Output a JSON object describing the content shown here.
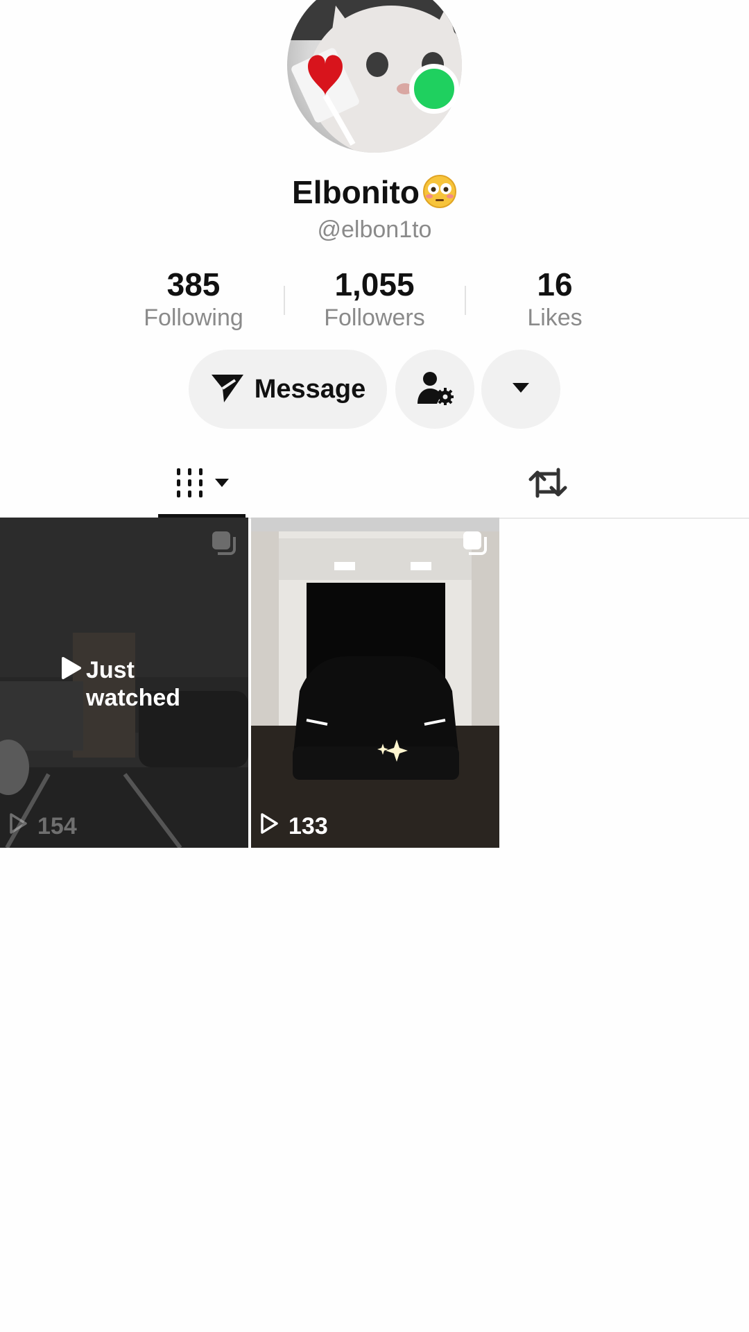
{
  "profile": {
    "display_name": "Elbonito",
    "display_emoji": "flushed-face",
    "username": "@elbon1to",
    "online_status_color": "#1fd05f"
  },
  "stats": {
    "following": {
      "value": "385",
      "label": "Following"
    },
    "followers": {
      "value": "1,055",
      "label": "Followers"
    },
    "likes": {
      "value": "16",
      "label": "Likes"
    }
  },
  "actions": {
    "message_label": "Message",
    "message_icon": "send-icon",
    "friend_icon": "person-settings-icon",
    "more_icon": "caret-down-icon"
  },
  "tabs": [
    {
      "name": "videos",
      "icon": "grid-lines-icon",
      "has_dropdown": true,
      "active": true
    },
    {
      "name": "reposts",
      "icon": "repost-icon",
      "active": false
    }
  ],
  "videos": [
    {
      "views": "154",
      "overlay_label": "Just watched",
      "thumbnail": "parking-lot-night"
    },
    {
      "views": "133",
      "thumbnail": "black-car-in-garage"
    }
  ]
}
